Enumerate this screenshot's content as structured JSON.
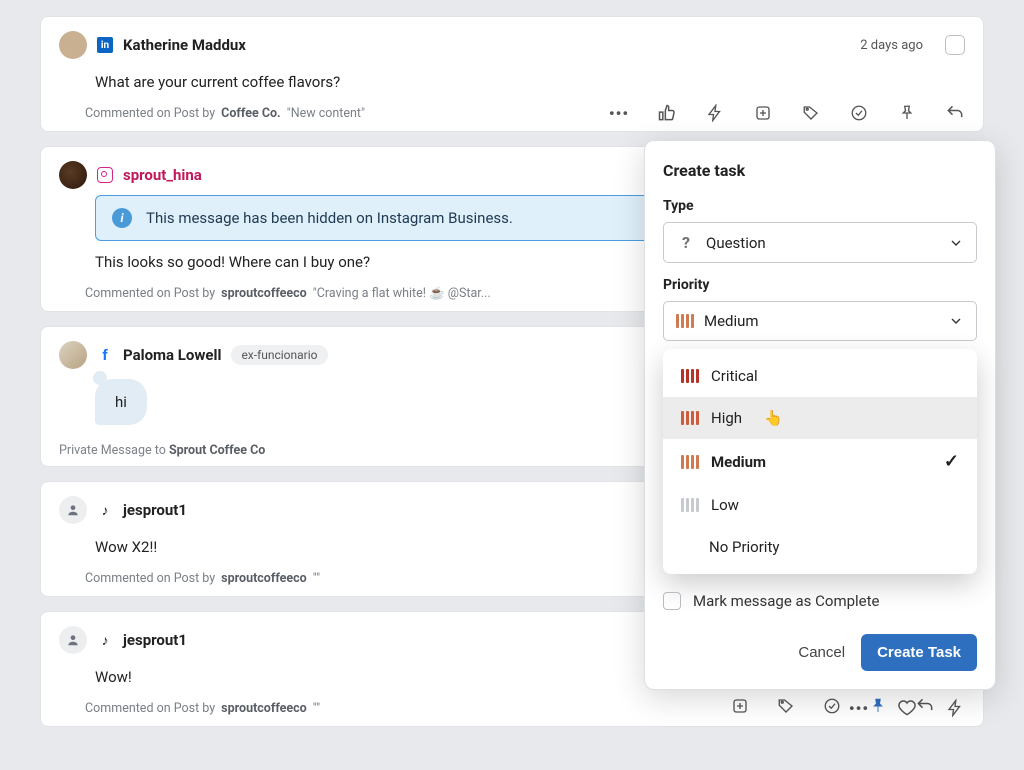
{
  "posts": [
    {
      "author": "Katherine Maddux",
      "timestamp": "2 days ago",
      "body": "What are your current coffee flavors?",
      "meta_prefix": "Commented on Post by ",
      "meta_source": "Coffee Co.",
      "meta_quote": " \"New content\""
    },
    {
      "author": "sprout_hina",
      "banner": "This message has been hidden on Instagram Business.",
      "body": "This looks so good! Where can I buy one?",
      "meta_prefix": "Commented on Post by ",
      "meta_source": "sproutcoffeeco",
      "meta_quote": " \"Craving a flat white! ☕ @Star..."
    },
    {
      "author": "Paloma Lowell",
      "tag": "ex-funcionario",
      "bubble": "hi",
      "meta_prefix": "Private Message to ",
      "meta_source": "Sprout Coffee Co"
    },
    {
      "author": "jesprout1",
      "body": "Wow X2!!",
      "meta_prefix": "Commented on Post by ",
      "meta_source": "sproutcoffeeco",
      "meta_quote": " \"\""
    },
    {
      "author": "jesprout1",
      "body": "Wow!",
      "meta_prefix": "Commented on Post by ",
      "meta_source": "sproutcoffeeco",
      "meta_quote": " \"\""
    }
  ],
  "panel": {
    "title": "Create task",
    "type_label": "Type",
    "type_value": "Question",
    "priority_label": "Priority",
    "priority_value": "Medium",
    "options": {
      "critical": "Critical",
      "high": "High",
      "medium": "Medium",
      "low": "Low",
      "none": "No Priority"
    },
    "mark_complete": "Mark message as Complete",
    "cancel": "Cancel",
    "submit": "Create Task"
  }
}
